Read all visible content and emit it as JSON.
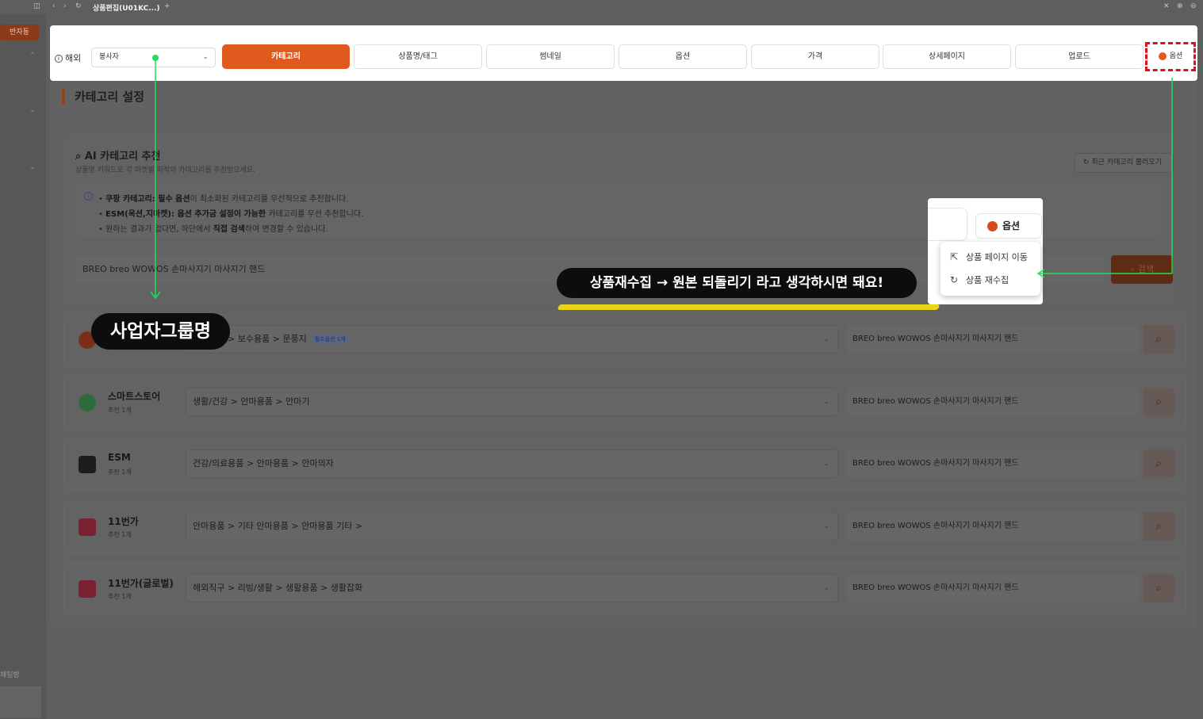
{
  "window": {
    "tab_title": "상품편집(U01KC...)"
  },
  "sidebar": {
    "badge": "반자동",
    "bottom_label": "채팅방"
  },
  "topbar": {
    "overseas_label": "해외",
    "business_select": "봉사자",
    "tabs": [
      {
        "label": "카테고리",
        "active": true
      },
      {
        "label": "상품명/태그",
        "active": false
      },
      {
        "label": "썸네일",
        "active": false
      },
      {
        "label": "옵션",
        "active": false
      },
      {
        "label": "가격",
        "active": false
      },
      {
        "label": "상세페이지",
        "active": false
      },
      {
        "label": "업로드",
        "active": false
      }
    ],
    "option_tab_label": "옵션"
  },
  "section": {
    "title": "카테고리 설정"
  },
  "ai": {
    "title": "AI 카테고리 추천",
    "subtitle": "상품명 키워드로 각 마켓별 최적의 카테고리를 추천받으세요.",
    "recent_button": "최근 카테고리 불러오기",
    "info": {
      "line1_bold": "쿠팡 카테고리: 필수 옵션",
      "line1_rest": "이 최소화된 카테고리를 우선적으로 추천합니다.",
      "line2_bold": "ESM(옥션,지마켓): 옵션 추가금 설정이 가능한",
      "line2_rest": " 카테고리를 우선 추천합니다.",
      "line3_pre": "원하는 결과가 없다면, 하단에서 ",
      "line3_bold": "직접 검색",
      "line3_rest": "하여 변경할 수 있습니다."
    },
    "keyword": "BREO breo WOWOS 손마사지기 마사지기 핸드",
    "search_button": "검색"
  },
  "markets": [
    {
      "name": "쿠팡",
      "rec": "추천 1개",
      "category": "> 보수용품 > 문풍지",
      "badge": "필수옵션 1개",
      "keyword": "BREO breo WOWOS 손마사지기 마사지기 핸드"
    },
    {
      "name": "스마트스토어",
      "rec": "추천 1개",
      "category": "생활/건강 > 안마용품 > 안마기",
      "badge": "",
      "keyword": "BREO breo WOWOS 손마사지기 마사지기 핸드"
    },
    {
      "name": "ESM",
      "rec": "추천 1개",
      "category": "건강/의료용품 > 안마용품 > 안마의자",
      "badge": "",
      "keyword": "BREO breo WOWOS 손마사지기 마사지기 핸드"
    },
    {
      "name": "11번가",
      "rec": "추천 1개",
      "category": "안마용품 > 기타 안마용품 > 안마용품 기타 >",
      "badge": "",
      "keyword": "BREO breo WOWOS 손마사지기 마사지기 핸드"
    },
    {
      "name": "11번가(글로벌)",
      "rec": "추천 1개",
      "category": "해외직구 > 리빙/생활 > 생활용품 > 생활잡화",
      "badge": "",
      "keyword": "BREO breo WOWOS 손마사지기 마사지기 핸드"
    }
  ],
  "popup": {
    "option_label": "옵션",
    "menu": [
      {
        "label": "상품 페이지 이동",
        "icon": "external-link-icon"
      },
      {
        "label": "상품 재수집",
        "icon": "refresh-icon"
      }
    ]
  },
  "annotations": {
    "business_group": "사업자그룹명",
    "note": "상품재수집 → 원본 되돌리기 라고 생각하시면 돼요!"
  },
  "colors": {
    "accent": "#e05a1e",
    "arrow": "#22dd55",
    "highlight": "#f0da14",
    "dashed_box": "#e0101a"
  }
}
